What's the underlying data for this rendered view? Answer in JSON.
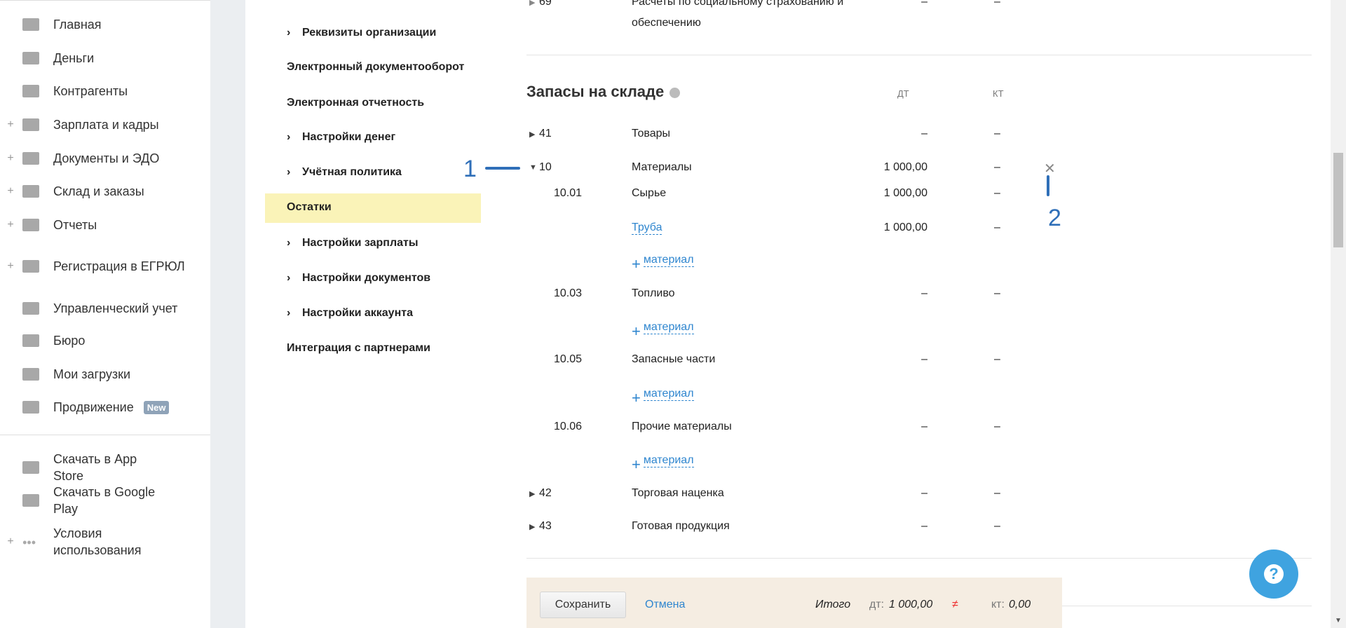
{
  "sidebar": {
    "items": [
      {
        "label": "Главная",
        "icon": "home-icon",
        "plus": false
      },
      {
        "label": "Деньги",
        "icon": "money-icon",
        "plus": false
      },
      {
        "label": "Контрагенты",
        "icon": "contractors-icon",
        "plus": false
      },
      {
        "label": "Зарплата и кадры",
        "icon": "wallet-icon",
        "plus": true
      },
      {
        "label": "Документы и ЭДО",
        "icon": "folder-icon",
        "plus": true
      },
      {
        "label": "Склад и заказы",
        "icon": "warehouse-icon",
        "plus": true
      },
      {
        "label": "Отчеты",
        "icon": "report-icon",
        "plus": true
      },
      {
        "label": "Регистрация в ЕГРЮЛ",
        "icon": "registration-icon",
        "plus": true
      },
      {
        "label": "Управленческий учет",
        "icon": "management-icon",
        "plus": false
      },
      {
        "label": "Бюро",
        "icon": "briefcase-icon",
        "plus": false
      },
      {
        "label": "Мои загрузки",
        "icon": "download-icon",
        "plus": false
      },
      {
        "label": "Продвижение",
        "icon": "promotion-icon",
        "plus": false,
        "badge": "New"
      }
    ],
    "bottom": [
      {
        "label": "Скачать в App Store",
        "icon": "apple-icon"
      },
      {
        "label": "Скачать в Google Play",
        "icon": "google-play-icon"
      },
      {
        "label": "Условия использования",
        "icon": "more-icon"
      }
    ]
  },
  "settings_nav": [
    {
      "label": "Реквизиты организации",
      "chevron": true
    },
    {
      "label": "Электронный документооборот",
      "chevron": false
    },
    {
      "label": "Электронная отчетность",
      "chevron": false
    },
    {
      "label": "Настройки денег",
      "chevron": true
    },
    {
      "label": "Учётная политика",
      "chevron": true
    },
    {
      "label": "Остатки",
      "chevron": false,
      "active": true
    },
    {
      "label": "Настройки зарплаты",
      "chevron": true
    },
    {
      "label": "Настройки документов",
      "chevron": true
    },
    {
      "label": "Настройки аккаунта",
      "chevron": true
    },
    {
      "label": "Интеграция с партнерами",
      "chevron": false
    }
  ],
  "prev_row": {
    "code": "69",
    "name_line1": "Расчеты по социальному страхованию и",
    "name_line2": "обеспечению",
    "dt": "–",
    "kt": "–"
  },
  "section": {
    "title": "Запасы на складе",
    "col_dt": "ДТ",
    "col_kt": "КТ"
  },
  "rows": [
    {
      "type": "account",
      "arrow": "▶",
      "code": "41",
      "name": "Товары",
      "dt": "–",
      "kt": "–"
    },
    {
      "type": "account",
      "arrow": "▼",
      "code": "10",
      "name": "Материалы",
      "dt": "1 000,00",
      "kt": "–"
    },
    {
      "type": "sub",
      "code": "10.01",
      "name": "Сырье",
      "dt": "1 000,00",
      "kt": "–"
    },
    {
      "type": "item",
      "name": "Труба",
      "dt": "1 000,00",
      "kt": "–"
    },
    {
      "type": "add",
      "label": "материал"
    },
    {
      "type": "sub",
      "code": "10.03",
      "name": "Топливо",
      "dt": "–",
      "kt": "–"
    },
    {
      "type": "add",
      "label": "материал"
    },
    {
      "type": "sub",
      "code": "10.05",
      "name": "Запасные части",
      "dt": "–",
      "kt": "–"
    },
    {
      "type": "add",
      "label": "материал"
    },
    {
      "type": "sub",
      "code": "10.06",
      "name": "Прочие материалы",
      "dt": "–",
      "kt": "–"
    },
    {
      "type": "add",
      "label": "материал"
    },
    {
      "type": "account",
      "arrow": "▶",
      "code": "42",
      "name": "Торговая наценка",
      "dt": "–",
      "kt": "–"
    },
    {
      "type": "account",
      "arrow": "▶",
      "code": "43",
      "name": "Готовая продукция",
      "dt": "–",
      "kt": "–"
    }
  ],
  "annotations": {
    "one": "1",
    "two": "2",
    "color": "#2f6fb8"
  },
  "footer": {
    "save": "Сохранить",
    "cancel": "Отмена",
    "total_label": "Итого",
    "dt_label": "дт:",
    "dt_value": "1 000,00",
    "neq": "≠",
    "kt_label": "кт:",
    "kt_value": "0,00"
  },
  "help": {
    "label": "?",
    "color": "#3fa3e0"
  }
}
